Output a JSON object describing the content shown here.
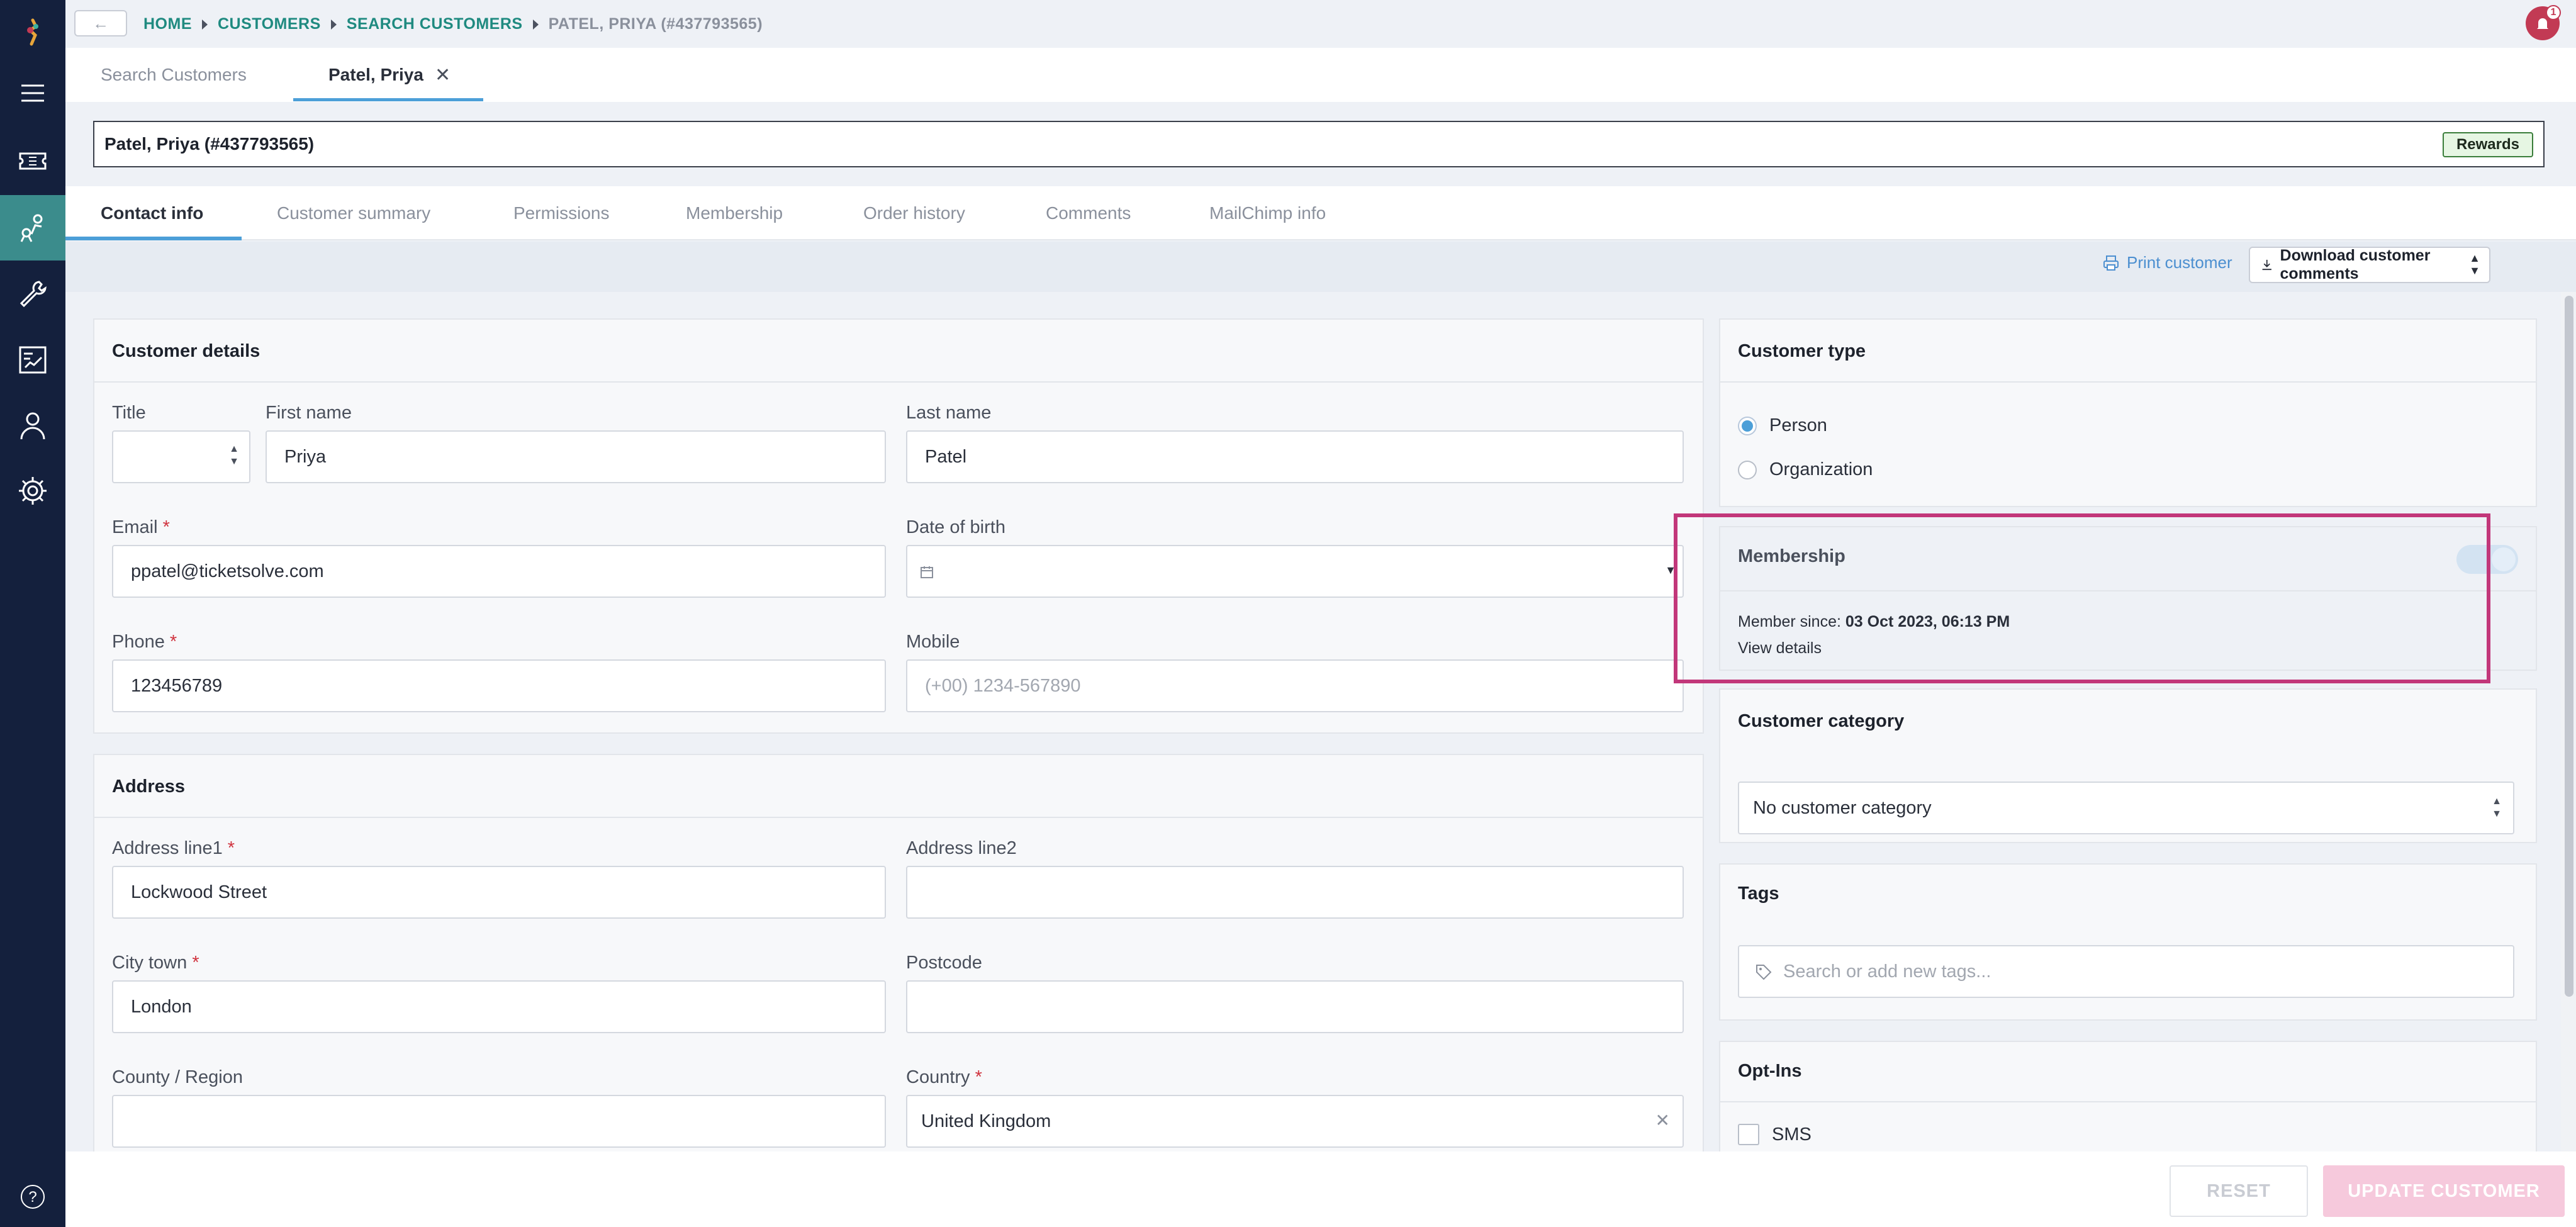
{
  "breadcrumb": {
    "home": "HOME",
    "customers": "CUSTOMERS",
    "search": "SEARCH CUSTOMERS",
    "current": "PATEL, PRIYA (#437793565)"
  },
  "notifications": {
    "count": "1"
  },
  "page_tabs": [
    {
      "label": "Search Customers"
    },
    {
      "label": "Patel, Priya"
    }
  ],
  "customer": {
    "header": "Patel, Priya (#437793565)",
    "rewards_label": "Rewards"
  },
  "section_tabs": [
    {
      "label": "Contact info"
    },
    {
      "label": "Customer summary"
    },
    {
      "label": "Permissions"
    },
    {
      "label": "Membership"
    },
    {
      "label": "Order history"
    },
    {
      "label": "Comments"
    },
    {
      "label": "MailChimp info"
    }
  ],
  "toolbar": {
    "print": "Print customer",
    "download": "Download customer comments"
  },
  "details": {
    "title": "Customer details",
    "title_label": "Title",
    "first_name_label": "First name",
    "first_name": "Priya",
    "last_name_label": "Last name",
    "last_name": "Patel",
    "email_label": "Email",
    "email": "ppatel@ticketsolve.com",
    "dob_label": "Date of birth",
    "phone_label": "Phone",
    "phone": "123456789",
    "mobile_label": "Mobile",
    "mobile_placeholder": "(+00) 1234-567890"
  },
  "address": {
    "title": "Address",
    "line1_label": "Address line1",
    "line1": "Lockwood Street",
    "line2_label": "Address line2",
    "city_label": "City town",
    "city": "London",
    "postcode_label": "Postcode",
    "county_label": "County / Region",
    "country_label": "Country",
    "country": "United Kingdom"
  },
  "customer_type": {
    "title": "Customer type",
    "options": [
      "Person",
      "Organization"
    ],
    "selected": "Person"
  },
  "membership": {
    "title": "Membership",
    "since_label": "Member since:",
    "since_value": "03 Oct 2023, 06:13 PM",
    "view_details": "View details"
  },
  "category": {
    "title": "Customer category",
    "selected": "No customer category"
  },
  "tags": {
    "title": "Tags",
    "placeholder": "Search or add new tags..."
  },
  "optins": {
    "title": "Opt-Ins",
    "sms": "SMS"
  },
  "footer": {
    "reset": "RESET",
    "update": "UPDATE CUSTOMER"
  },
  "icons": {
    "logo": "brand-logo-icon",
    "menu": "menu-icon",
    "tickets": "ticket-icon",
    "customers": "customers-icon",
    "tools": "wrench-icon",
    "reports": "reports-icon",
    "user": "user-icon",
    "settings": "gear-icon",
    "help": "help-icon"
  },
  "colors": {
    "nav_bg": "#14203d",
    "nav_active": "#3b8c8c",
    "accent_blue": "#4c9fd8",
    "link_teal": "#1f8a80",
    "highlight": "#c2377a",
    "update_button": "#f6c9dc"
  }
}
